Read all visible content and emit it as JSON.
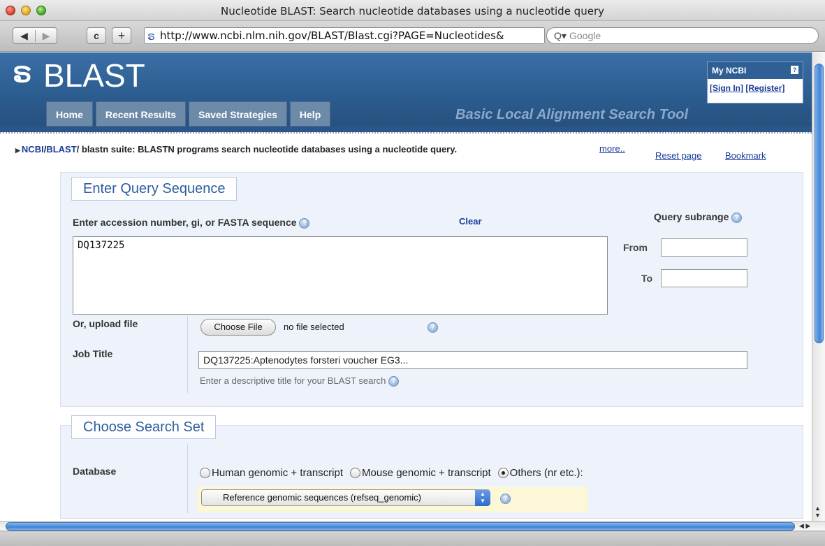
{
  "window": {
    "title": "Nucleotide BLAST: Search nucleotide databases using a nucleotide query",
    "url": "http://www.ncbi.nlm.nih.gov/BLAST/Blast.cgi?PAGE=Nucleotides&",
    "search_placeholder": "Google",
    "reload_label": "c",
    "add_label": "+"
  },
  "header": {
    "logo": "BLAST",
    "tagline": "Basic Local Alignment Search Tool",
    "tabs": [
      "Home",
      "Recent Results",
      "Saved Strategies",
      "Help"
    ],
    "my_ncbi": {
      "title": "My NCBI",
      "help": "?",
      "sign_in": "[Sign In]",
      "register": "[Register]"
    }
  },
  "breadcrumb": {
    "ncbi": "NCBI",
    "blast": "BLAST",
    "text": "blastn suite: BLASTN programs search nucleotide databases using a nucleotide query.",
    "more": "more..",
    "reset": "Reset page",
    "bookmark": "Bookmark"
  },
  "query": {
    "legend": "Enter Query Sequence",
    "seq_label": "Enter accession number, gi, or FASTA sequence",
    "clear": "Clear",
    "sequence": "DQ137225",
    "subrange_label": "Query subrange",
    "from_label": "From",
    "to_label": "To",
    "upload_label": "Or, upload file",
    "choose_file": "Choose File",
    "file_status": "no file selected",
    "job_title_label": "Job Title",
    "job_title_value": "DQ137225:Aptenodytes forsteri voucher EG3...",
    "job_title_hint": "Enter a descriptive title for your BLAST search"
  },
  "search_set": {
    "legend": "Choose Search Set",
    "database_label": "Database",
    "options": [
      "Human genomic + transcript",
      "Mouse genomic + transcript",
      "Others (nr etc.):"
    ],
    "selected_option": "Others (nr etc.):",
    "database_value": "Reference genomic sequences (refseq_genomic)"
  },
  "colors": {
    "header_blue": "#2b5b8e",
    "link_blue": "#1a3c9b",
    "panel_bg": "#eef3fb",
    "legend_text": "#2e5c9d",
    "highlight": "#fbf7d7"
  }
}
